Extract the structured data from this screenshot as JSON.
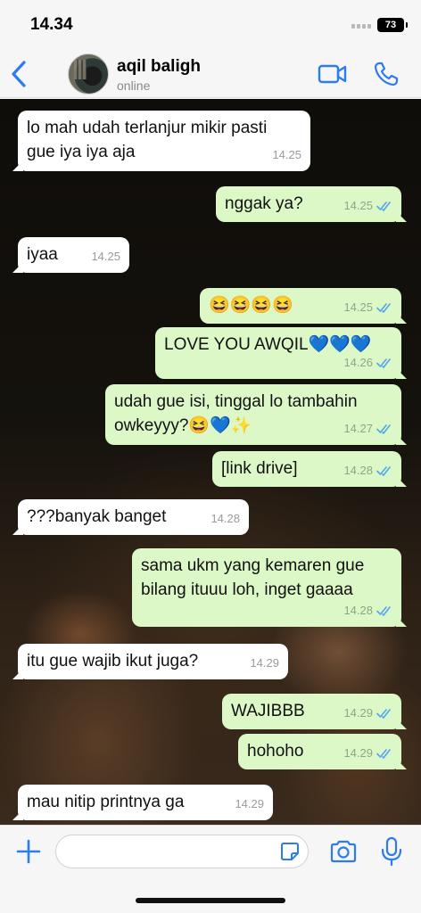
{
  "status_bar": {
    "time": "14.34",
    "battery": "73"
  },
  "header": {
    "contact_name": "aqil baligh",
    "contact_status": "online"
  },
  "messages": [
    {
      "direction": "in",
      "text": "lo mah udah terlanjur mikir pasti\ngue iya iya aja",
      "time": "14.25"
    },
    {
      "direction": "out",
      "text": "nggak ya?",
      "time": "14.25",
      "read": true
    },
    {
      "direction": "in",
      "text": "iyaa",
      "time": "14.25"
    },
    {
      "direction": "out",
      "text": "😆😆😆😆",
      "time": "14.25",
      "read": true
    },
    {
      "direction": "out",
      "text": "LOVE YOU AWQIL💙💙💙",
      "time": "14.26",
      "read": true
    },
    {
      "direction": "out",
      "text": "udah gue isi, tinggal lo tambahin\nowkeyyy?😆💙✨",
      "time": "14.27",
      "read": true
    },
    {
      "direction": "out",
      "text": "[link drive]",
      "time": "14.28",
      "read": true
    },
    {
      "direction": "in",
      "text": "???banyak banget",
      "time": "14.28"
    },
    {
      "direction": "out",
      "text": "sama ukm yang kemaren gue\nbilang ituuu loh, inget gaaaa",
      "time": "14.28",
      "read": true
    },
    {
      "direction": "in",
      "text": "itu gue wajib ikut juga?",
      "time": "14.29"
    },
    {
      "direction": "out",
      "text": "WAJIBBB",
      "time": "14.29",
      "read": true
    },
    {
      "direction": "out",
      "text": "hohoho",
      "time": "14.29",
      "read": true
    },
    {
      "direction": "in",
      "text": "mau nitip printnya ga",
      "time": "14.29"
    }
  ],
  "composer": {
    "placeholder": ""
  },
  "colors": {
    "accent": "#2c7bf0",
    "outgoing_bubble": "#dcf8c6",
    "incoming_bubble": "#ffffff",
    "read_tick": "#53a5f4"
  },
  "icons": [
    "back-chevron-icon",
    "video-call-icon",
    "phone-call-icon",
    "plus-icon",
    "sticker-icon",
    "camera-icon",
    "microphone-icon",
    "double-check-icon"
  ]
}
